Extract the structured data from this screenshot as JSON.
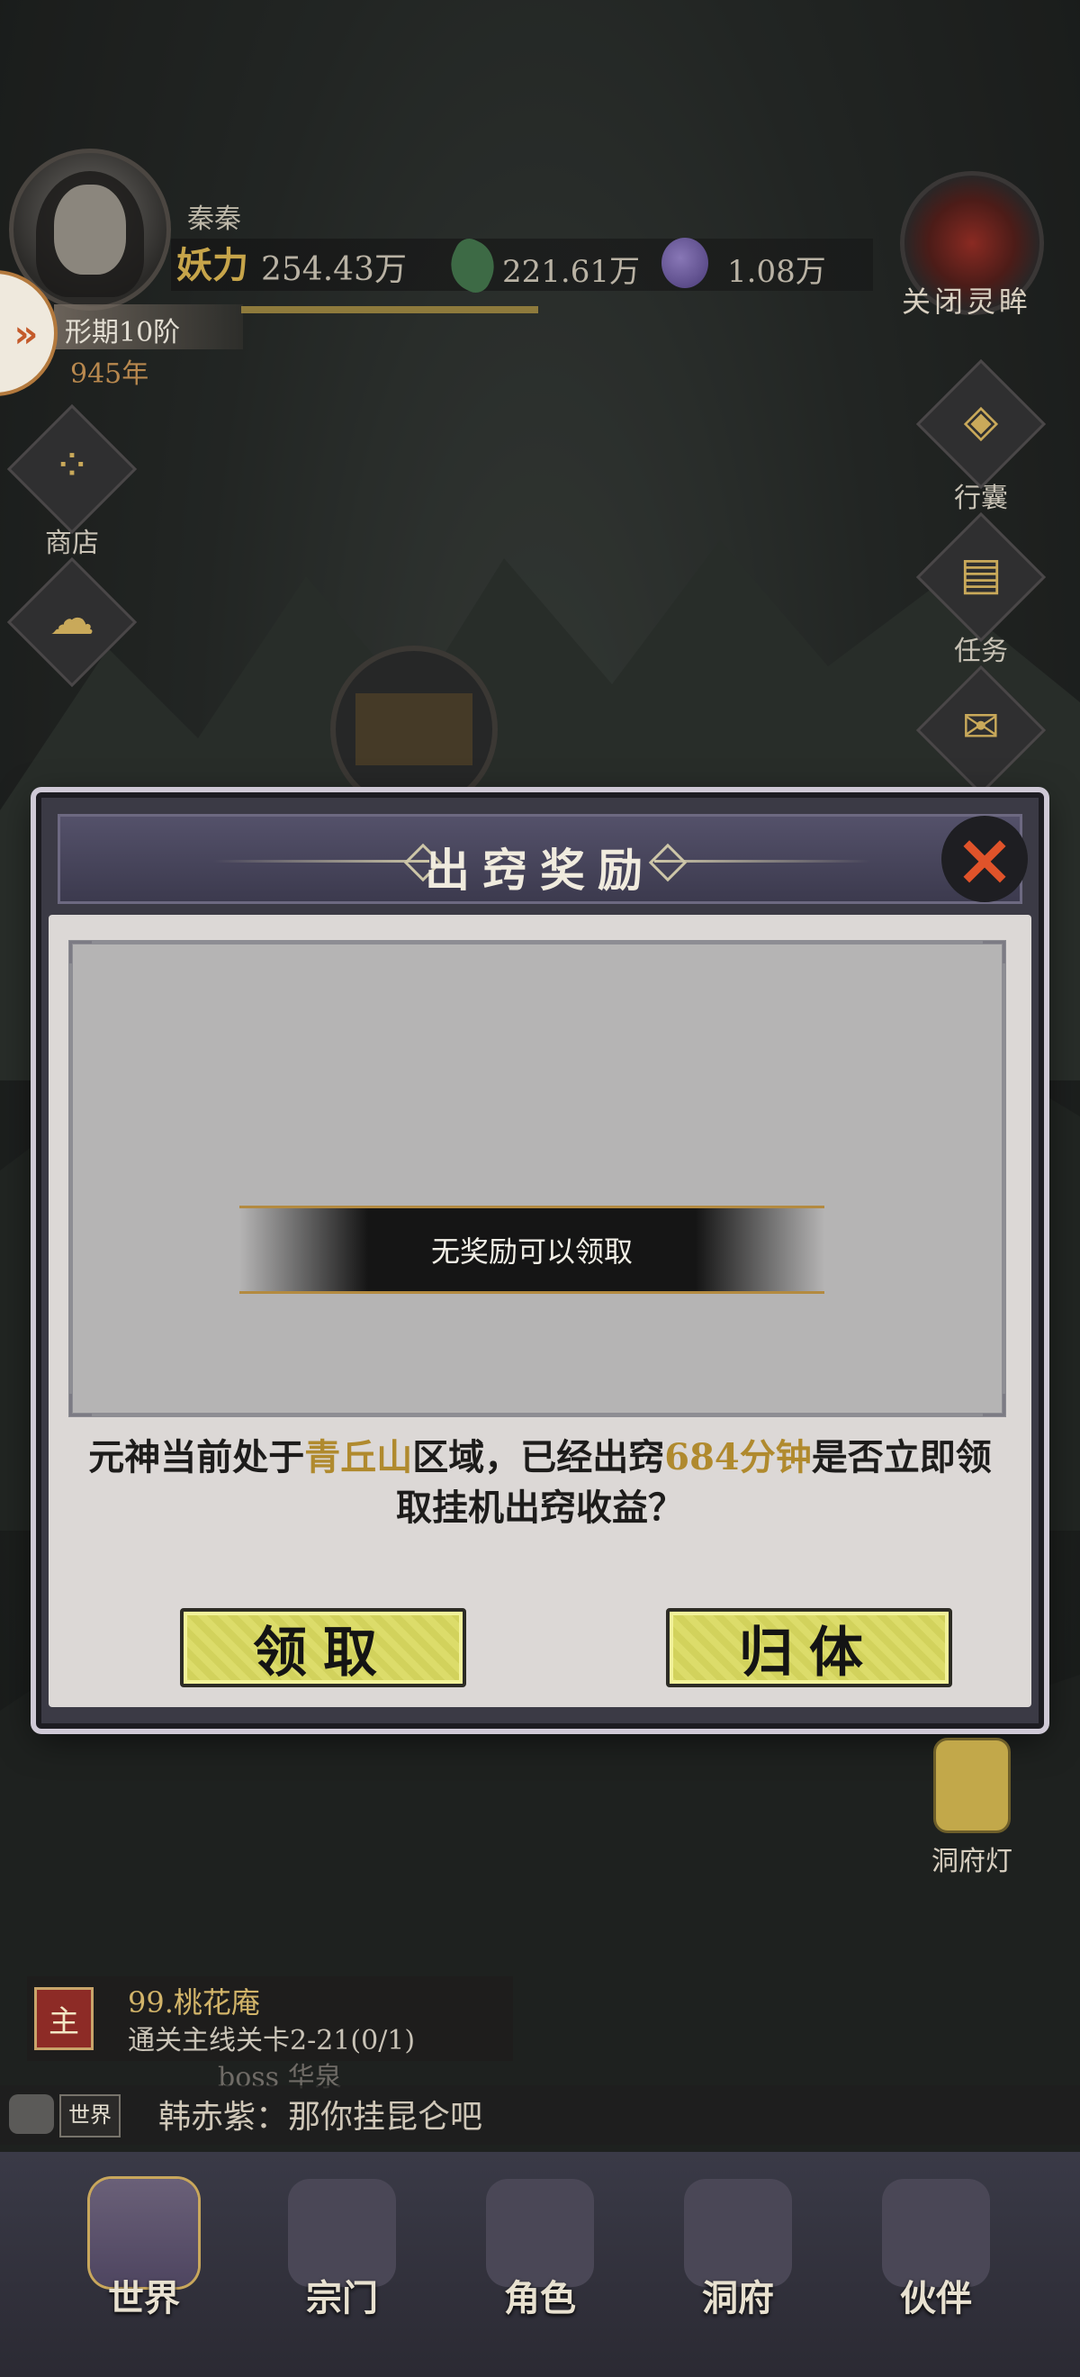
{
  "player": {
    "name": "秦秦",
    "yaoli_label": "妖力",
    "yaoli_value": "254.43万",
    "resource_1": "221.61万",
    "resource_2": "1.08万",
    "realm": "形期10阶",
    "years": "945年"
  },
  "left_side": {
    "shop": "商店"
  },
  "right_side": {
    "close_eye": "关闭灵眸",
    "bag": "行囊",
    "task": "任务"
  },
  "dialog": {
    "title": "出窍奖励",
    "close_icon": "×",
    "no_reward": "无奖励可以领取",
    "message_part1": "元神当前处于",
    "message_area": "青丘山",
    "message_part2": "区域，已经出窍",
    "message_time": "684分钟",
    "message_part3": "是否立即领取挂机出窍收益？",
    "claim_button": "领取",
    "return_button": "归体"
  },
  "lantern": {
    "label": "洞府灯"
  },
  "quest": {
    "tag": "主",
    "title": "99.桃花庵",
    "desc": "通关主线关卡2-21(0/1)",
    "boss": "boss  华泉"
  },
  "chat": {
    "channel": "世界",
    "message": "韩赤紫：那你挂昆仑吧"
  },
  "nav": [
    {
      "label": "世界"
    },
    {
      "label": "宗门"
    },
    {
      "label": "角色"
    },
    {
      "label": "洞府"
    },
    {
      "label": "伙伴"
    }
  ],
  "colors": {
    "highlight": "#b08a2e",
    "button_yellow": "#dcdc6a",
    "close_red": "#e0532a"
  }
}
